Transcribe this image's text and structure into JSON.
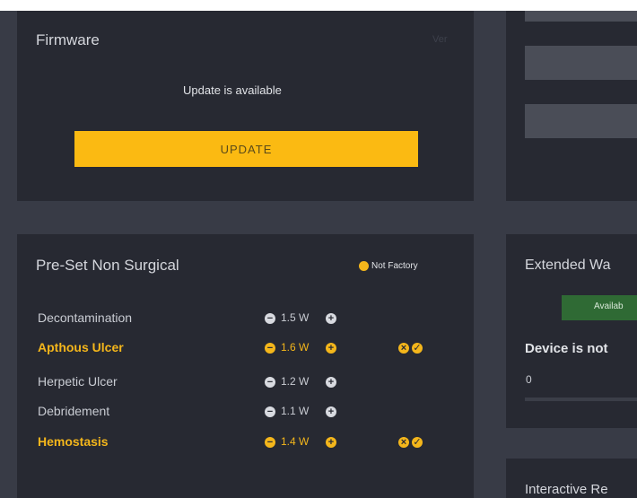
{
  "firmware": {
    "title": "Firmware",
    "ver_label": "Ver",
    "status": "Update is available",
    "update_button": "UPDATE"
  },
  "preset": {
    "title": "Pre-Set Non Surgical",
    "badge": "Not Factory",
    "items": [
      {
        "name": "Decontamination",
        "power": "1.5 W",
        "modified": false
      },
      {
        "name": "Apthous Ulcer",
        "power": "1.6 W",
        "modified": true
      },
      {
        "name": "Herpetic Ulcer",
        "power": "1.2 W",
        "modified": false
      },
      {
        "name": "Debridement",
        "power": "1.1 W",
        "modified": false
      },
      {
        "name": "Hemostasis",
        "power": "1.4 W",
        "modified": true
      }
    ]
  },
  "warranty": {
    "title": "Extended Wa",
    "available_label": "Availab",
    "device_status": "Device is not",
    "value": "0"
  },
  "interactive": {
    "title": "Interactive Re"
  },
  "colors": {
    "accent": "#fbba12",
    "background": "#383b46",
    "card": "#272932",
    "available_green": "#2f6a34"
  }
}
